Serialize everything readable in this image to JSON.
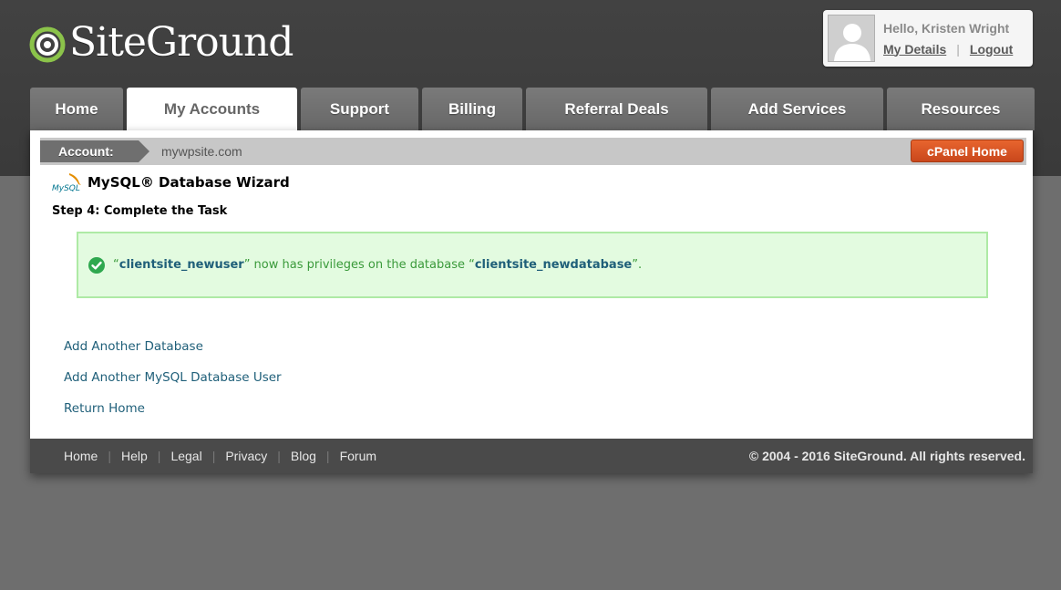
{
  "header": {
    "logo_text": "SiteGround",
    "user": {
      "greeting": "Hello, Kristen Wright",
      "my_details": "My Details",
      "logout": "Logout"
    }
  },
  "nav": {
    "tabs": [
      {
        "label": "Home",
        "active": false
      },
      {
        "label": "My Accounts",
        "active": true
      },
      {
        "label": "Support",
        "active": false
      },
      {
        "label": "Billing",
        "active": false
      },
      {
        "label": "Referral Deals",
        "active": false
      },
      {
        "label": "Add Services",
        "active": false
      },
      {
        "label": "Resources",
        "active": false
      }
    ]
  },
  "account_bar": {
    "label": "Account:",
    "value": "mywpsite.com",
    "cpanel_button": "cPanel Home"
  },
  "wizard": {
    "logo_text": "MySQL",
    "title": "MySQL® Database Wizard",
    "step": "Step 4: Complete the Task",
    "message": {
      "open_quote": "“",
      "user": "clientsite_newuser",
      "middle": "” now has privileges on the database “",
      "database": "clientsite_newdatabase",
      "end": "”."
    },
    "links": [
      "Add Another Database",
      "Add Another MySQL Database User",
      "Return Home"
    ]
  },
  "footer": {
    "links": [
      "Home",
      "Help",
      "Legal",
      "Privacy",
      "Blog",
      "Forum"
    ],
    "copyright": "© 2004 - 2016 SiteGround. All rights reserved."
  },
  "colors": {
    "accent_orange": "#d9542a",
    "link_blue": "#1f5f79",
    "success_green": "#3a9a3a"
  }
}
